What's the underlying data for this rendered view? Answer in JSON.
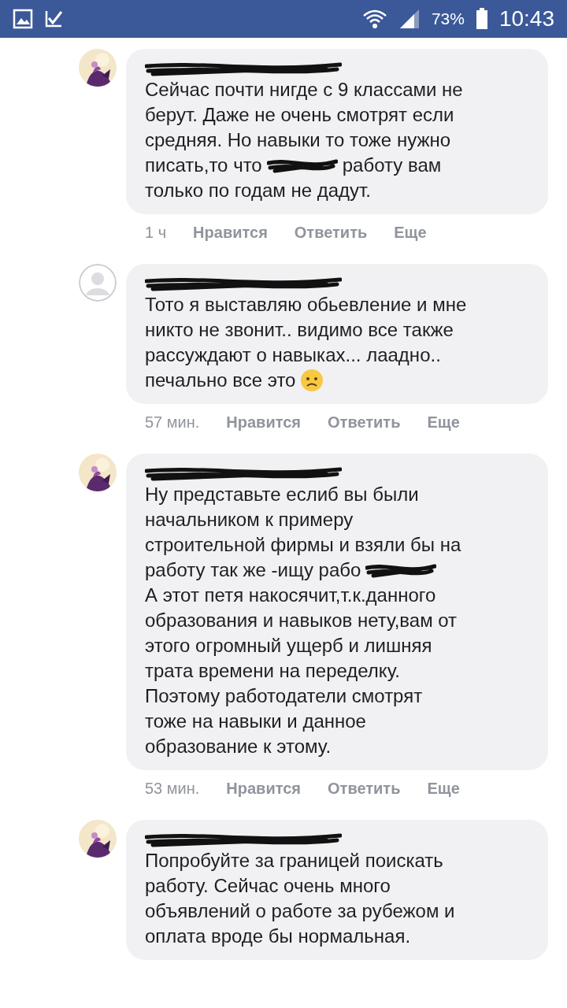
{
  "status_bar": {
    "battery_percent": "73%",
    "time": "10:43"
  },
  "comments": [
    {
      "avatar": {
        "kind": "picture"
      },
      "lines": [
        [
          {
            "kind": "text",
            "text": "Сейчас почти нигде с 9 классами не"
          }
        ],
        [
          {
            "kind": "text",
            "text": "берут. Даже не очень смотрят если"
          }
        ],
        [
          {
            "kind": "text",
            "text": "средняя. Но навыки то тоже нужно"
          }
        ],
        [
          {
            "kind": "text",
            "text": "писать,то что"
          },
          {
            "kind": "redaction"
          },
          {
            "kind": "text",
            "text": "работу вам"
          }
        ],
        [
          {
            "kind": "text",
            "text": "только по годам не дадут."
          }
        ]
      ],
      "time": "1 ч",
      "actions": [
        "Нравится",
        "Ответить",
        "Еще"
      ]
    },
    {
      "avatar": {
        "kind": "placeholder"
      },
      "lines": [
        [
          {
            "kind": "text",
            "text": "Тото я выставляю обьевление и мне"
          }
        ],
        [
          {
            "kind": "text",
            "text": "никто не звонит.. видимо все также"
          }
        ],
        [
          {
            "kind": "text",
            "text": "рассуждают о навыках... лаадно.."
          }
        ],
        [
          {
            "kind": "text",
            "text": "печально все это"
          },
          {
            "kind": "emoji"
          }
        ]
      ],
      "time": "57 мин.",
      "actions": [
        "Нравится",
        "Ответить",
        "Еще"
      ]
    },
    {
      "avatar": {
        "kind": "picture"
      },
      "lines": [
        [
          {
            "kind": "text",
            "text": "Ну представьте еслиб вы были"
          }
        ],
        [
          {
            "kind": "text",
            "text": "начальником к примеру"
          }
        ],
        [
          {
            "kind": "text",
            "text": "строительной фирмы и взяли бы на"
          }
        ],
        [
          {
            "kind": "text",
            "text": "работу так же -ищу рабо"
          },
          {
            "kind": "redaction"
          }
        ],
        [
          {
            "kind": "text",
            "text": "А этот петя накосячит,т.к.данного"
          }
        ],
        [
          {
            "kind": "text",
            "text": "образования и навыков нету,вам от"
          }
        ],
        [
          {
            "kind": "text",
            "text": "этого огромный ущерб и лишняя"
          }
        ],
        [
          {
            "kind": "text",
            "text": "трата времени на переделку."
          }
        ],
        [
          {
            "kind": "text",
            "text": "Поэтому работодатели смотрят"
          }
        ],
        [
          {
            "kind": "text",
            "text": "тоже на навыки и данное"
          }
        ],
        [
          {
            "kind": "text",
            "text": "образование к этому."
          }
        ]
      ],
      "time": "53 мин.",
      "actions": [
        "Нравится",
        "Ответить",
        "Еще"
      ]
    },
    {
      "avatar": {
        "kind": "picture"
      },
      "lines": [
        [
          {
            "kind": "text",
            "text": "Попробуйте за границей поискать"
          }
        ],
        [
          {
            "kind": "text",
            "text": "работу. Сейчас очень много"
          }
        ],
        [
          {
            "kind": "text",
            "text": "объявлений о работе за рубежом и"
          }
        ],
        [
          {
            "kind": "text",
            "text": "оплата вроде бы нормальная."
          }
        ]
      ]
    }
  ]
}
